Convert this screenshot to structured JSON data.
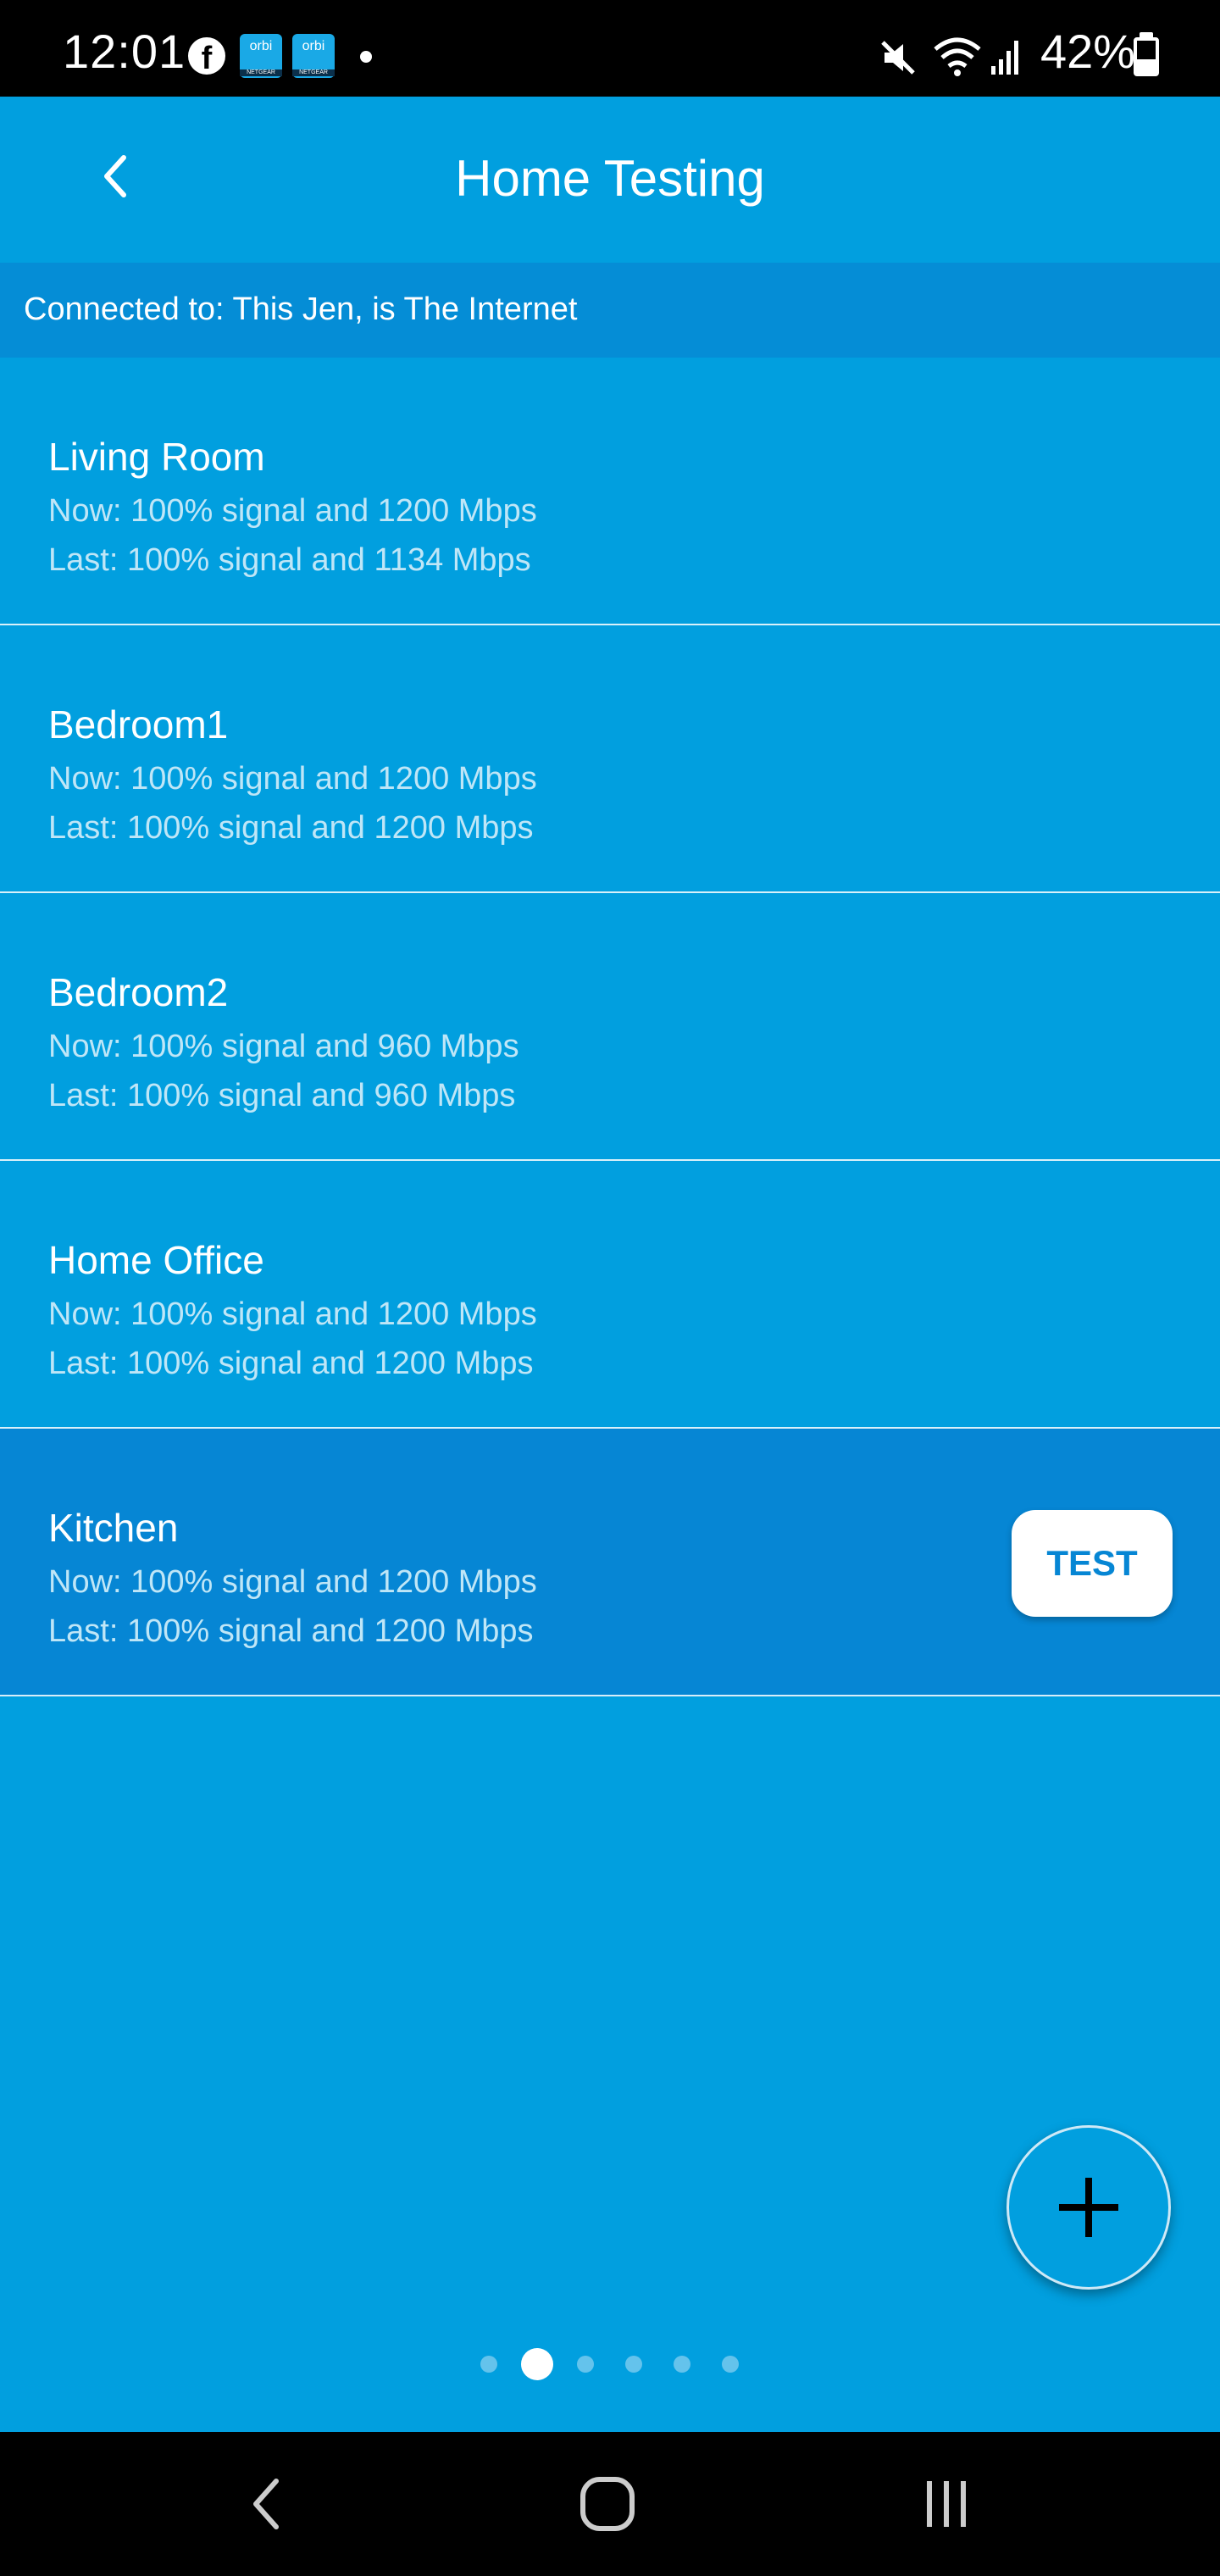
{
  "status_bar": {
    "time": "12:01",
    "facebook_icon": "facebook-icon",
    "orbi_icon_label": "orbi",
    "orbi_icon_sub": "NETGEAR",
    "battery_percent": "42%",
    "battery_level": 0.42
  },
  "header": {
    "title": "Home Testing",
    "back_icon": "chevron-left-icon"
  },
  "connection": {
    "text": "Connected to: This Jen, is The Internet"
  },
  "rooms": [
    {
      "name": "Living Room",
      "now": "Now: 100% signal and 1200 Mbps",
      "last": "Last: 100% signal and 1134 Mbps"
    },
    {
      "name": "Bedroom1",
      "now": "Now: 100% signal and 1200 Mbps",
      "last": "Last: 100% signal and 1200 Mbps"
    },
    {
      "name": "Bedroom2",
      "now": "Now: 100% signal and 960 Mbps",
      "last": "Last: 100% signal and 960 Mbps"
    },
    {
      "name": "Home Office",
      "now": "Now: 100% signal and 1200 Mbps",
      "last": "Last: 100% signal and 1200 Mbps"
    },
    {
      "name": "Kitchen",
      "now": "Now: 100% signal and 1200 Mbps",
      "last": "Last: 100% signal and 1200 Mbps"
    }
  ],
  "selected_room_index": 4,
  "test_button_label": "TEST",
  "fab_icon": "plus-icon",
  "pagination": {
    "total": 6,
    "current": 2
  },
  "colors": {
    "background": "#019fdf",
    "banner": "#058dd6",
    "selected_row": "#0686d4",
    "status_bar": "#000000"
  }
}
